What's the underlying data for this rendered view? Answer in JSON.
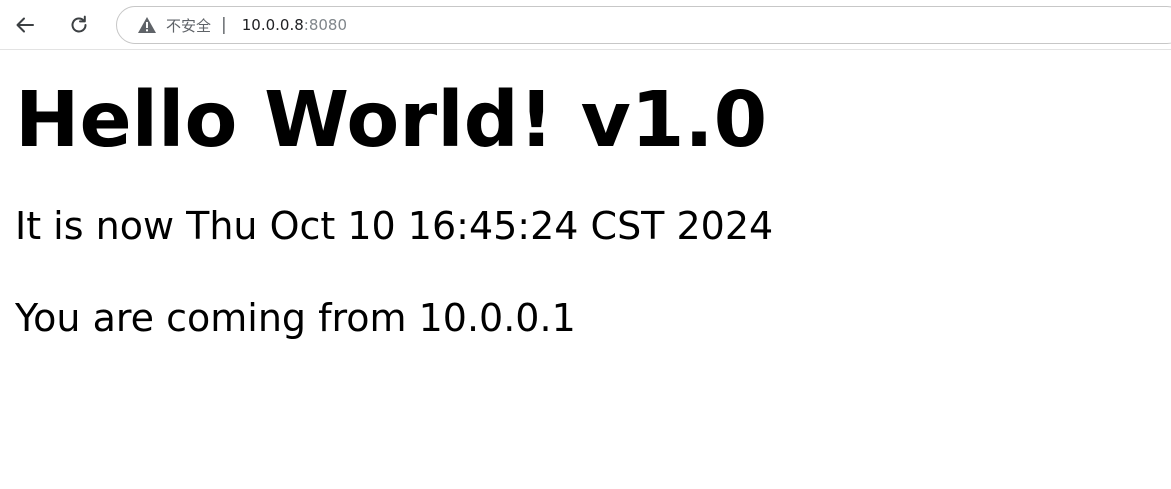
{
  "browser": {
    "security_label": "不安全",
    "separator": "|",
    "url_host": "10.0.0.8",
    "url_port": ":8080",
    "icons": {
      "back": "arrow-left-icon",
      "reload": "reload-icon",
      "security": "warning-triangle-icon"
    }
  },
  "page": {
    "heading": "Hello World! v1.0",
    "time_text": "It is now Thu Oct 10 16:45:24 CST 2024",
    "from_text": "You are coming from 10.0.0.1"
  },
  "colors": {
    "text": "#000000",
    "icon": "#5f6368",
    "url_port": "#80868b"
  }
}
